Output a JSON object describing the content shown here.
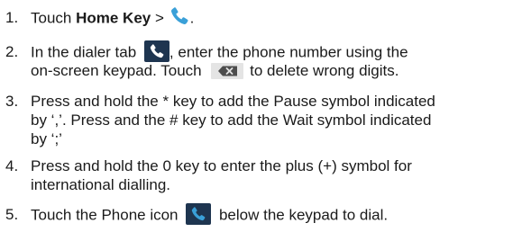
{
  "steps": [
    {
      "number": "1.",
      "lines": [
        {
          "before": "Touch ",
          "bold": "Home Key",
          "after": " > ",
          "tail": "."
        }
      ]
    },
    {
      "number": "2.",
      "line1_before": "In the dialer tab ",
      "line1_after": ", enter the phone number using the",
      "line2_before": "on-screen keypad. Touch ",
      "line2_after": " to delete wrong digits."
    },
    {
      "number": "3.",
      "lines": [
        "Press and hold the * key to add the Pause symbol indicated",
        "by ‘,’. Press and the # key to add the Wait symbol indicated",
        "by ‘;’"
      ]
    },
    {
      "number": "4.",
      "lines": [
        "Press and hold the 0 key to enter the plus (+) symbol for",
        "international dialling."
      ]
    },
    {
      "number": "5.",
      "before": "Touch the Phone icon ",
      "after": " below the keypad to dial."
    }
  ],
  "icons": {
    "phone": "phone-handset-icon",
    "delete": "delete-key-icon",
    "phone_color": "#3aa0d8",
    "tile_color": "#1e3550"
  }
}
